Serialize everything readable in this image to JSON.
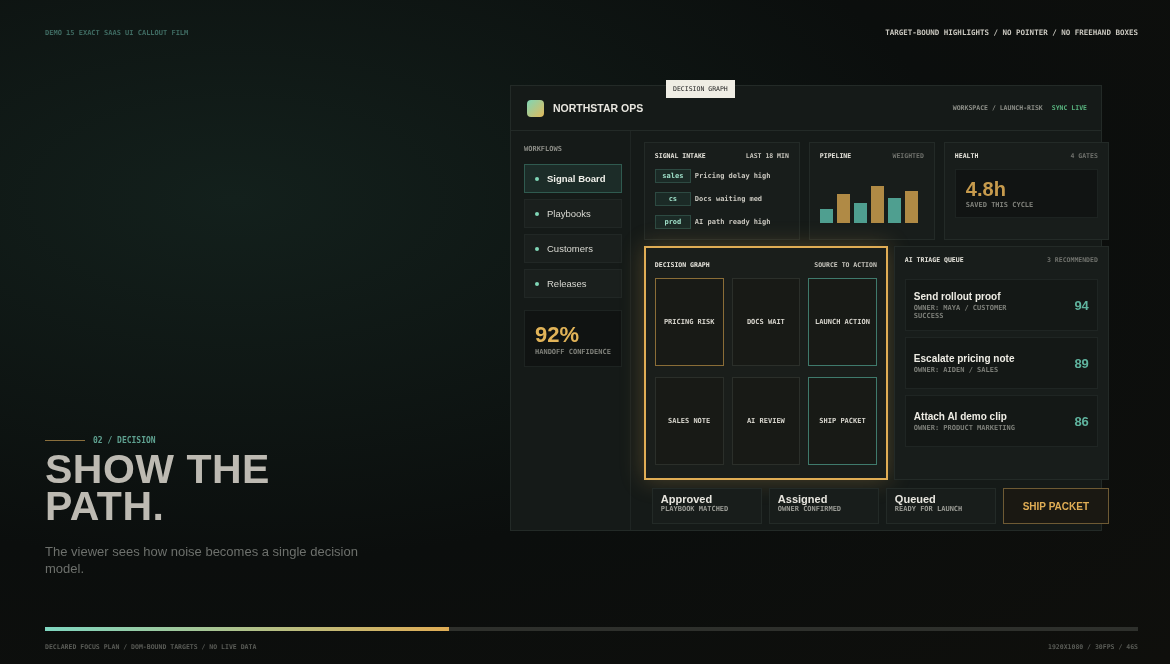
{
  "top_bar": {
    "left": "DEMO 15 EXACT SAAS UI CALLOUT FILM",
    "right": "TARGET-BOUND HIGHLIGHTS / NO POINTER / NO FREEHAND BOXES"
  },
  "hero": {
    "kicker": "02 / DECISION",
    "headline": "SHOW THE PATH.",
    "subtitle": "The viewer sees how noise becomes a single decision model."
  },
  "app": {
    "callout_label": "DECISION GRAPH",
    "brand": "NORTHSTAR OPS",
    "breadcrumb": "WORKSPACE / LAUNCH-RISK",
    "status": "SYNC LIVE",
    "sidebar": {
      "heading": "WORKFLOWS",
      "items": [
        {
          "label": "Signal Board",
          "selected": true
        },
        {
          "label": "Playbooks",
          "selected": false
        },
        {
          "label": "Customers",
          "selected": false
        },
        {
          "label": "Releases",
          "selected": false
        }
      ],
      "metric": {
        "value": "92%",
        "caption": "HANDOFF CONFIDENCE"
      }
    },
    "signal_intake": {
      "title": "SIGNAL INTAKE",
      "meta": "LAST 18 MIN",
      "rows": [
        {
          "tag": "sales",
          "text": "Pricing delay",
          "priority": "high"
        },
        {
          "tag": "cs",
          "text": "Docs waiting",
          "priority": "med"
        },
        {
          "tag": "prod",
          "text": "AI path ready",
          "priority": "high"
        }
      ]
    },
    "pipeline": {
      "title": "PIPELINE",
      "meta": "WEIGHTED"
    },
    "health": {
      "title": "HEALTH",
      "meta": "4 GATES",
      "value": "4.8h",
      "caption": "SAVED THIS CYCLE"
    },
    "decision_graph": {
      "title": "DECISION GRAPH",
      "meta": "SOURCE TO ACTION",
      "highlighted": true,
      "nodes": [
        {
          "label": "PRICING RISK",
          "kind": "source"
        },
        {
          "label": "DOCS WAIT",
          "kind": "plain"
        },
        {
          "label": "LAUNCH ACTION",
          "kind": "action"
        },
        {
          "label": "SALES NOTE",
          "kind": "plain"
        },
        {
          "label": "AI REVIEW",
          "kind": "plain"
        },
        {
          "label": "SHIP PACKET",
          "kind": "action"
        }
      ]
    },
    "triage": {
      "title": "AI TRIAGE QUEUE",
      "meta": "3 RECOMMENDED",
      "items": [
        {
          "title": "Send rollout proof",
          "owner": "OWNER: MAYA / CUSTOMER SUCCESS",
          "score": "94"
        },
        {
          "title": "Escalate pricing note",
          "owner": "OWNER: AIDEN / SALES",
          "score": "89"
        },
        {
          "title": "Attach AI demo clip",
          "owner": "OWNER: PRODUCT MARKETING",
          "score": "86"
        }
      ]
    },
    "statuses": [
      {
        "title": "Approved",
        "caption": "PLAYBOOK MATCHED"
      },
      {
        "title": "Assigned",
        "caption": "OWNER CONFIRMED"
      },
      {
        "title": "Queued",
        "caption": "READY FOR LAUNCH"
      }
    ],
    "action_button": "SHIP PACKET"
  },
  "progress": {
    "level": 0.37
  },
  "footer": {
    "left": "DECLARED FOCUS PLAN / DOM-BOUND TARGETS / NO LIVE DATA",
    "right": "1920X1080 / 30FPS / 46S"
  }
}
